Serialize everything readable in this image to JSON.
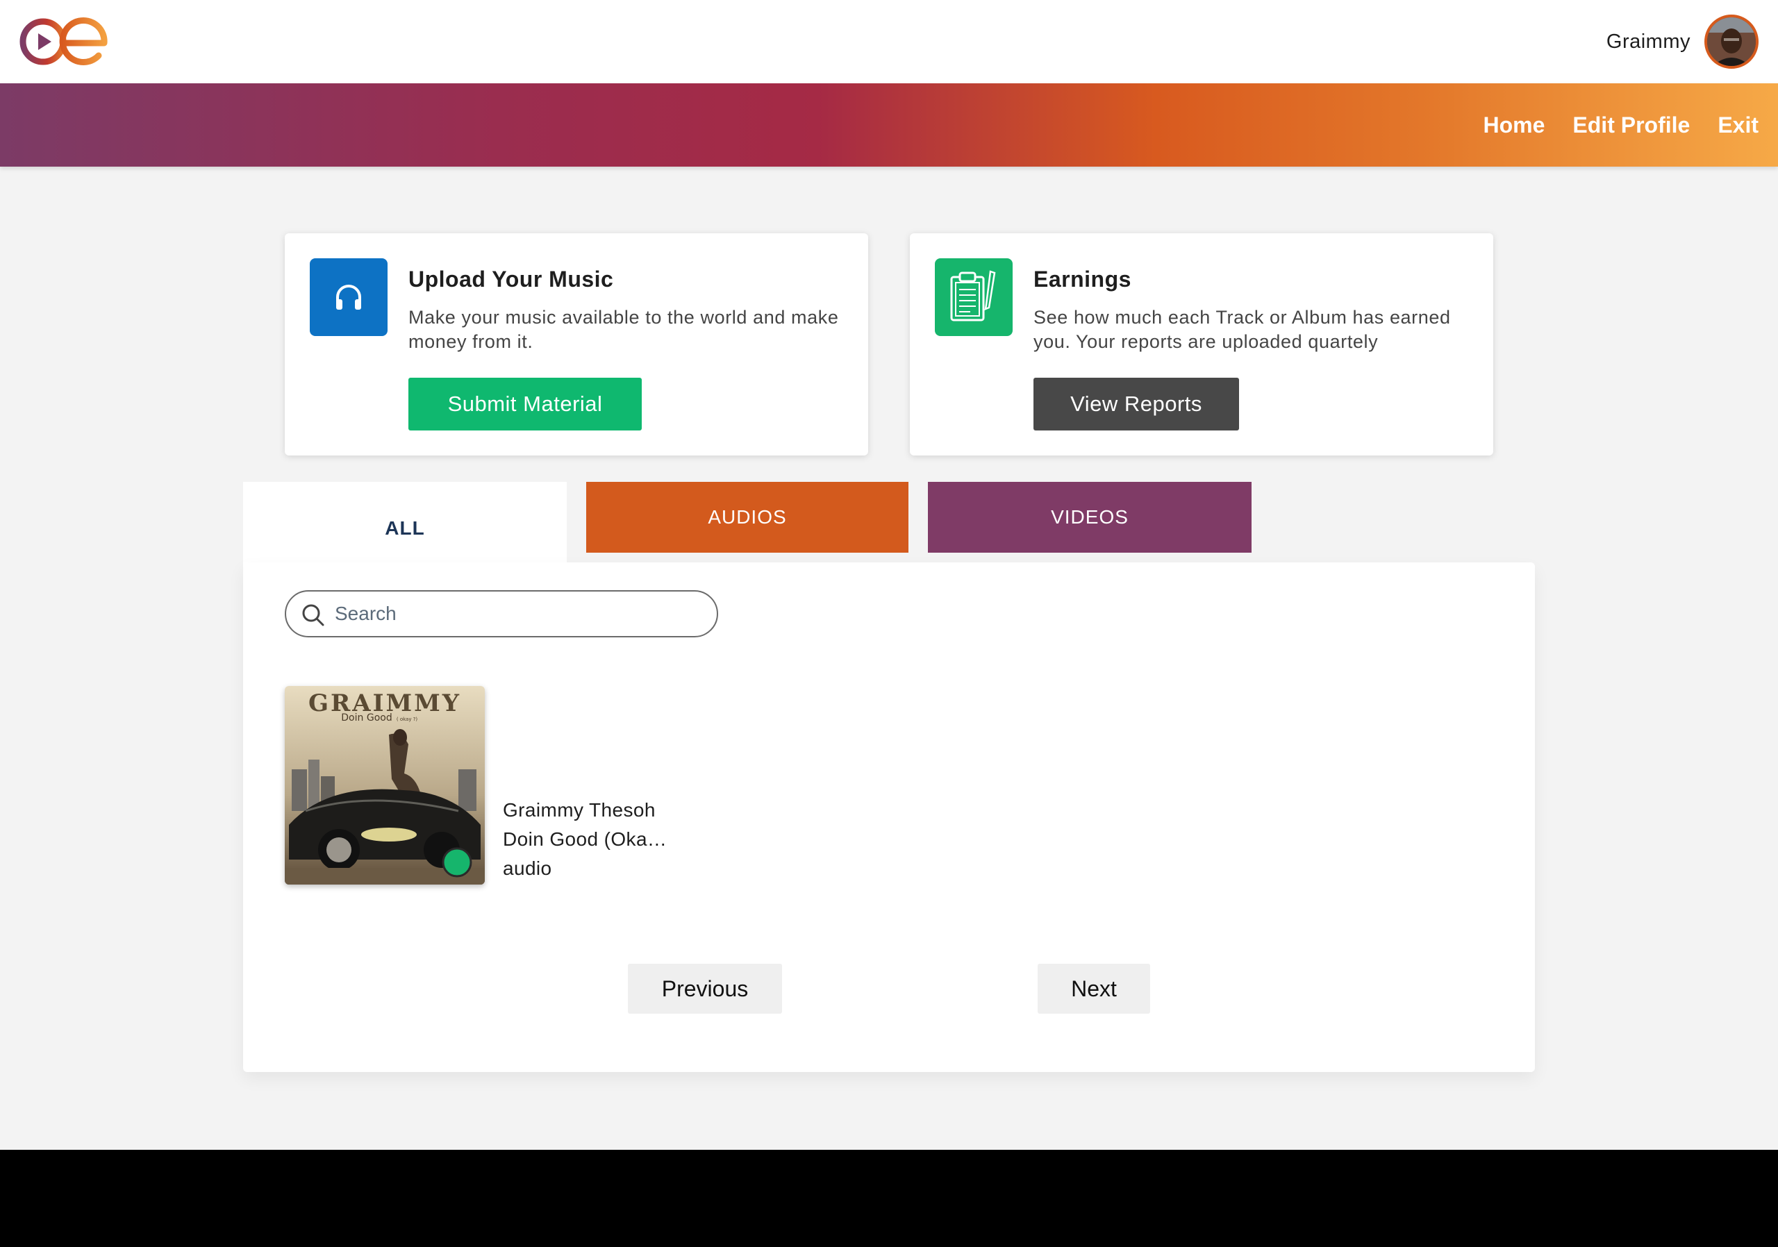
{
  "header": {
    "user_name": "Graimmy",
    "logo_icon": "oe-logo-icon",
    "avatar_icon": "user-avatar"
  },
  "nav": {
    "items": [
      {
        "label": "Home"
      },
      {
        "label": "Edit Profile"
      },
      {
        "label": "Exit"
      }
    ]
  },
  "cards": {
    "upload": {
      "icon": "headphones-icon",
      "title": "Upload Your Music",
      "description": "Make your music available to the world and make money from it.",
      "button": "Submit Material",
      "icon_color": "#0d72c4",
      "button_color": "#0fb86f"
    },
    "earnings": {
      "icon": "clipboard-icon",
      "title": "Earnings",
      "description": "See how much each Track or Album has earned you. Your reports are uploaded quartely",
      "button": "View Reports",
      "icon_color": "#16b56c",
      "button_color": "#484848"
    }
  },
  "tabs": [
    {
      "label": "ALL",
      "active": true
    },
    {
      "label": "AUDIOS",
      "color": "#d35a1d"
    },
    {
      "label": "VIDEOS",
      "color": "#7f3b66"
    }
  ],
  "search": {
    "placeholder": "Search",
    "value": ""
  },
  "media": [
    {
      "cover_title": "GRAIMMY",
      "cover_subtitle": "Doin Good",
      "cover_subtitle_small": "( okay ?)",
      "artist": "Graimmy Thesoh",
      "title": "Doin Good (Oka…",
      "type": "audio",
      "status_color": "#16b56c"
    }
  ],
  "pagination": {
    "previous": "Previous",
    "next": "Next"
  }
}
